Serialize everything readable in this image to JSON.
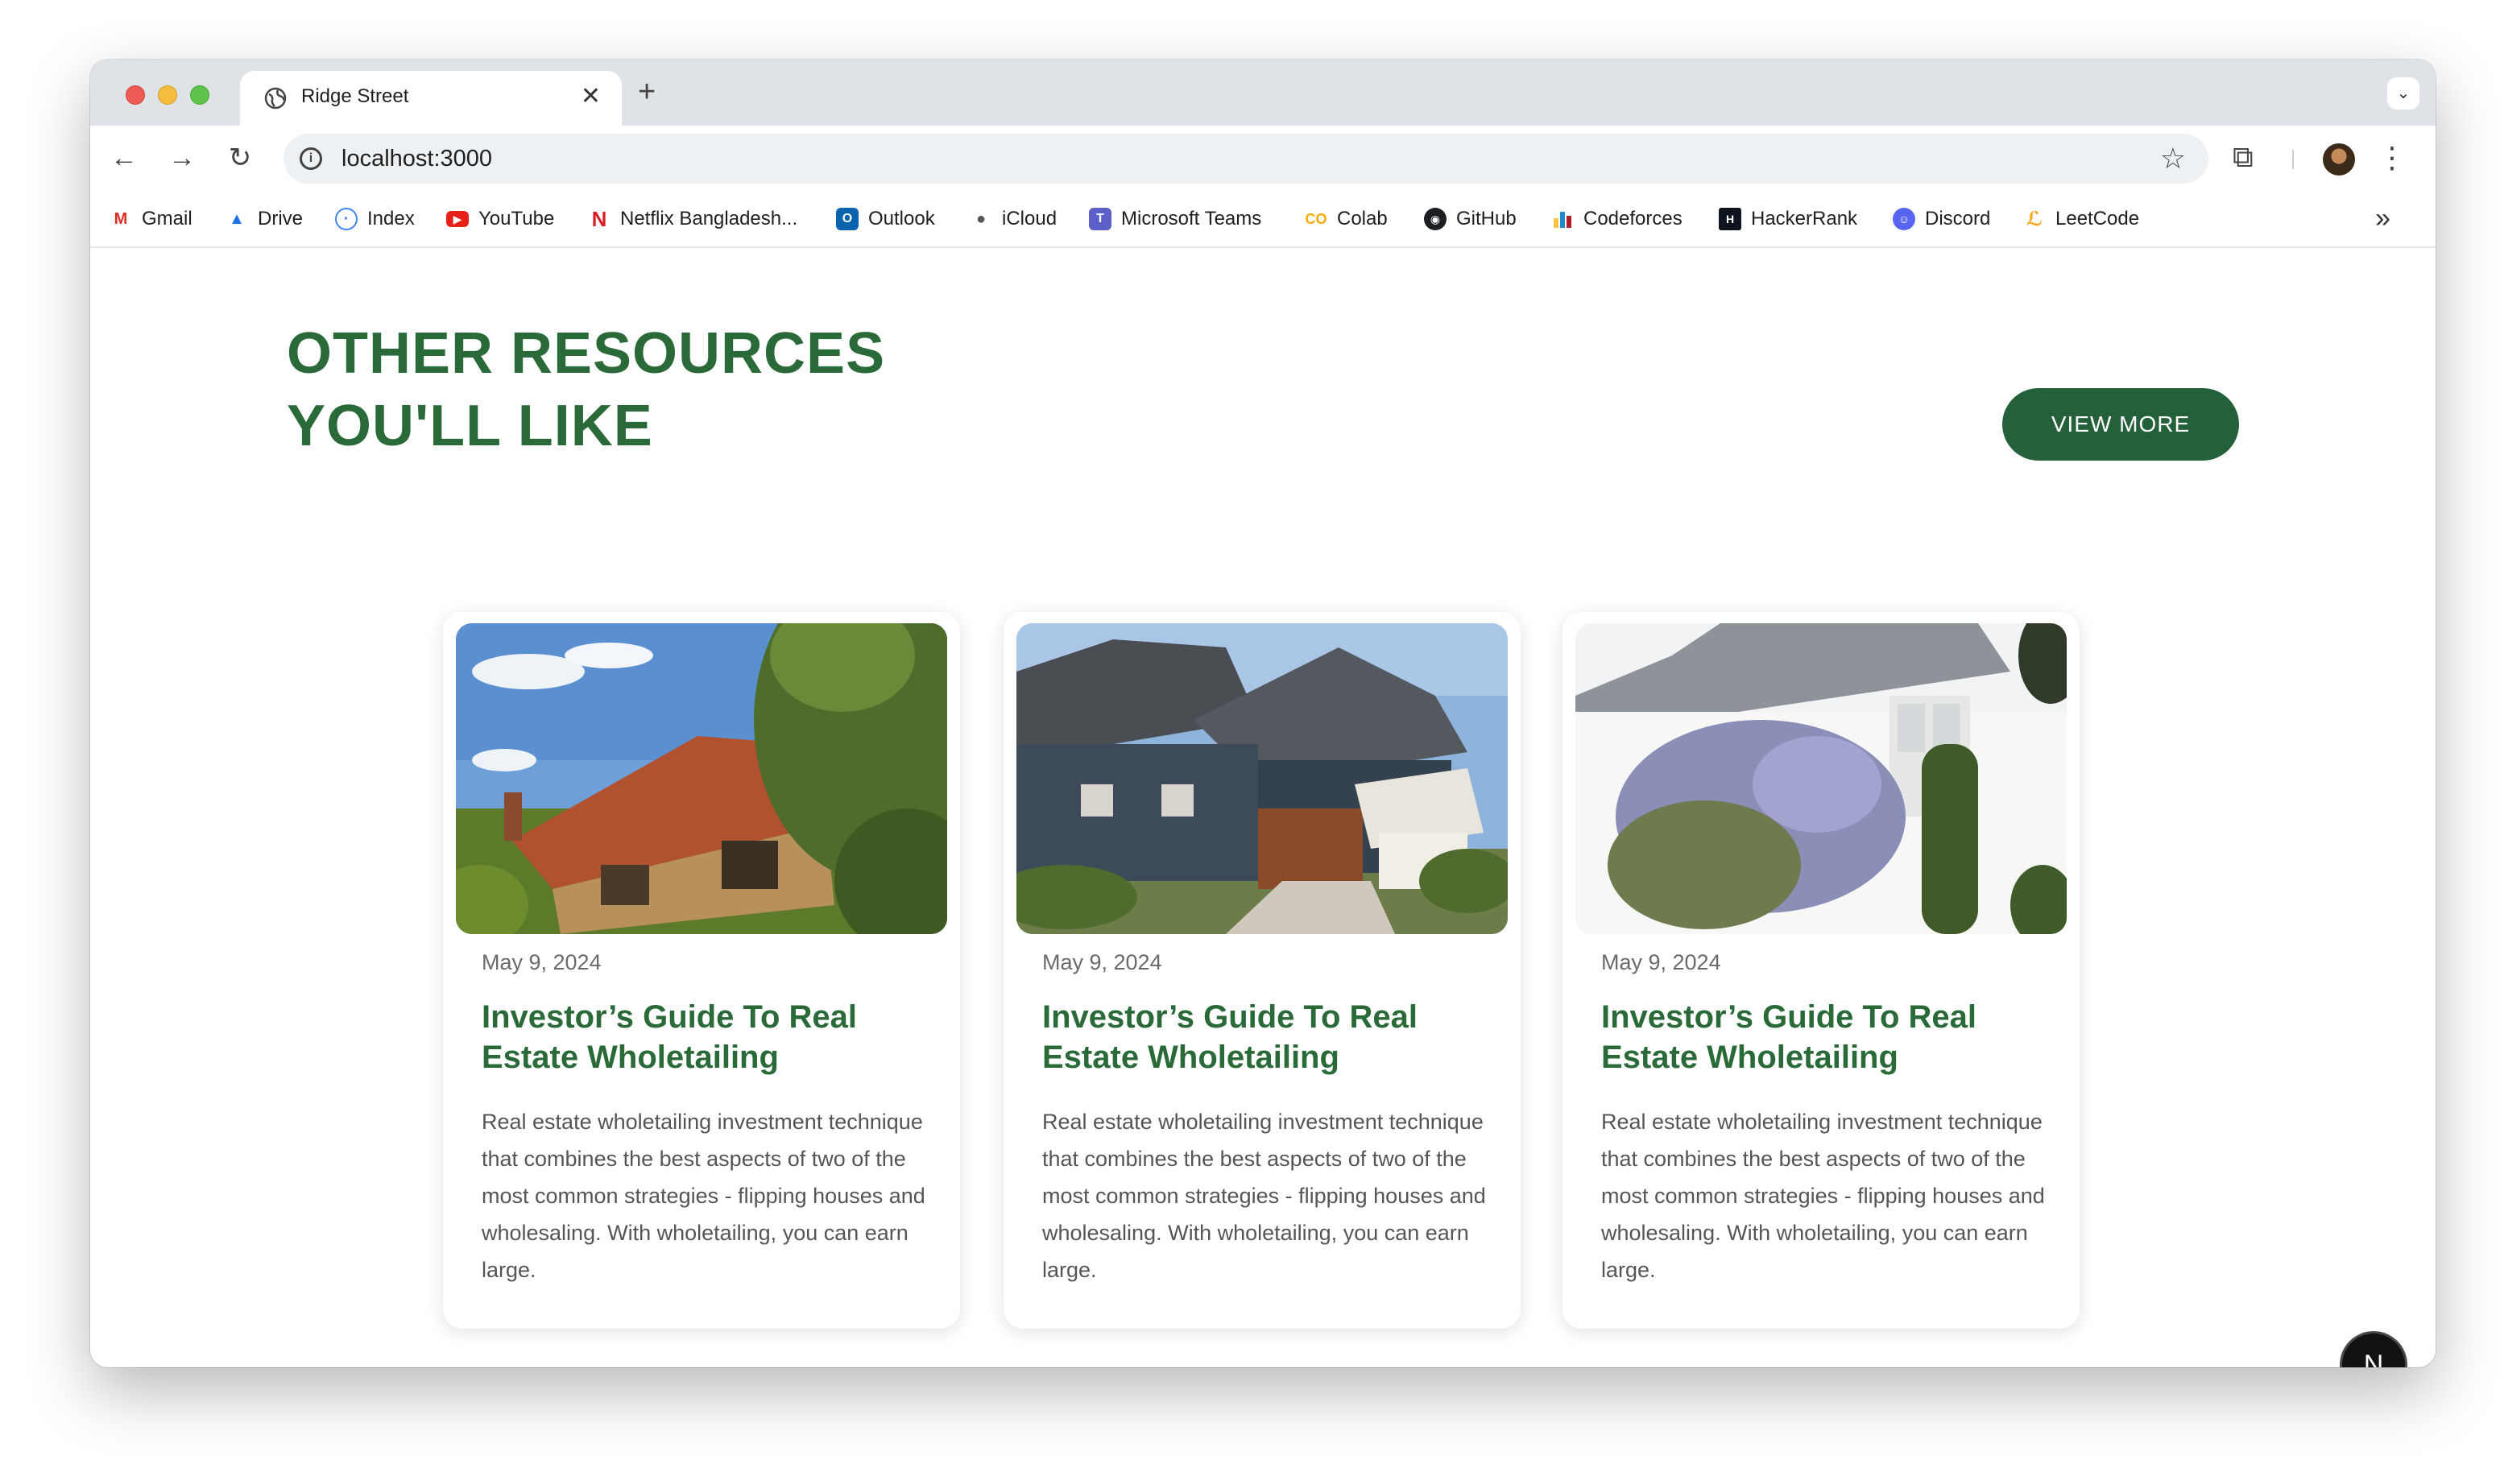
{
  "browser": {
    "tab_title": "Ridge Street",
    "tab_close": "✕",
    "new_tab": "+",
    "url": "localhost:3000",
    "bookmarks": [
      {
        "label": "Gmail",
        "color": "#d93025"
      },
      {
        "label": "Drive",
        "color": "#1a73e8"
      },
      {
        "label": "Index",
        "color": "#4285f4"
      },
      {
        "label": "YouTube",
        "color": "#e62117"
      },
      {
        "label": "Netflix Bangladesh...",
        "color": "#d81f26"
      },
      {
        "label": "Outlook",
        "color": "#0a64ad"
      },
      {
        "label": "iCloud",
        "color": "#555555"
      },
      {
        "label": "Microsoft Teams",
        "color": "#5b5fc7"
      },
      {
        "label": "Colab",
        "color": "#f9ab00"
      },
      {
        "label": "GitHub",
        "color": "#1b1f23"
      },
      {
        "label": "Codeforces",
        "color": "#1f8acb"
      },
      {
        "label": "HackerRank",
        "color": "#0e141e"
      },
      {
        "label": "Discord",
        "color": "#5865f2"
      },
      {
        "label": "LeetCode",
        "color": "#ffa116"
      }
    ]
  },
  "section": {
    "heading_line1": "OTHER RESOURCES",
    "heading_line2": "YOU'LL LIKE",
    "view_more": "VIEW MORE",
    "accent_color": "#2a6a39"
  },
  "cards": [
    {
      "date": "May 9, 2024",
      "title": "Investor’s Guide To Real Estate Wholetailing",
      "body": "Real estate wholetailing investment technique that combines the best aspects of two of the most common strategies - flipping houses and wholesaling. With wholetailing, you can earn large."
    },
    {
      "date": "May 9, 2024",
      "title": "Investor’s Guide To Real Estate Wholetailing",
      "body": "Real estate wholetailing investment technique that combines the best aspects of two of the most common strategies - flipping houses and wholesaling. With wholetailing, you can earn large."
    },
    {
      "date": "May 9, 2024",
      "title": "Investor’s Guide To Real Estate Wholetailing",
      "body": "Real estate wholetailing investment technique that combines the best aspects of two of the most common strategies - flipping houses and wholesaling. With wholetailing, you can earn large."
    }
  ],
  "dev_badge": "N"
}
